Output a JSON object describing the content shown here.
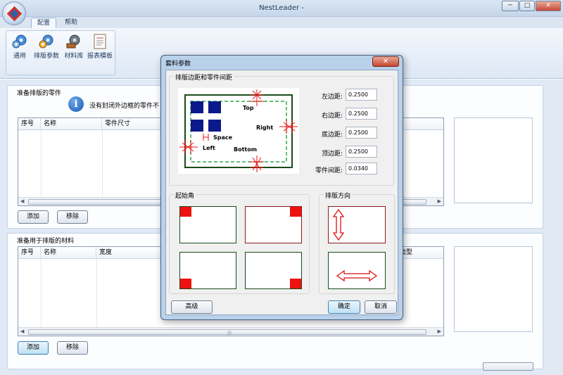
{
  "window": {
    "title": "NestLeader -",
    "controls": {
      "minimize": "─",
      "maximize": "□",
      "close": "✕"
    }
  },
  "menu_tabs": [
    {
      "label": "配置"
    },
    {
      "label": "帮助"
    }
  ],
  "ribbon": {
    "buttons": [
      {
        "label": "通用",
        "icon": "gears-icon"
      },
      {
        "label": "排版参数",
        "icon": "gears-icon"
      },
      {
        "label": "材料库",
        "icon": "gears-icon"
      },
      {
        "label": "报表模板",
        "icon": "report-icon"
      }
    ]
  },
  "parts_panel": {
    "title": "准备排版的零件",
    "info_text": "没有封闭外边框的零件不",
    "columns": [
      "序号",
      "名称",
      "零件尺寸"
    ],
    "add_button": "添加",
    "remove_button": "移除"
  },
  "materials_panel": {
    "title": "准备用于排版的材料",
    "columns": [
      "序号",
      "名称",
      "宽度",
      "",
      "",
      "类型"
    ],
    "add_button": "添加",
    "remove_button": "移除"
  },
  "dialog": {
    "title": "套料参数",
    "close": "✕",
    "margins_group": "排版边距和零件间距",
    "preview_labels": {
      "top": "Top",
      "right": "Right",
      "space": "Space",
      "left": "Left",
      "bottom": "Bottom"
    },
    "fields": [
      {
        "label": "左边距:",
        "value": "0.2500"
      },
      {
        "label": "右边距:",
        "value": "0.2500"
      },
      {
        "label": "底边距:",
        "value": "0.2500"
      },
      {
        "label": "顶边距:",
        "value": "0.2500"
      },
      {
        "label": "零件间距:",
        "value": "0.0340"
      }
    ],
    "start_corner_group": "起始角",
    "direction_group": "排版方向",
    "advanced_button": "高级",
    "ok_button": "确定",
    "cancel_button": "取消"
  },
  "colors": {
    "accent_red": "#ee1111",
    "part_blue": "#0a1a8a",
    "sheet_green": "#1a4a1a",
    "margin_green": "#2fa84a"
  }
}
